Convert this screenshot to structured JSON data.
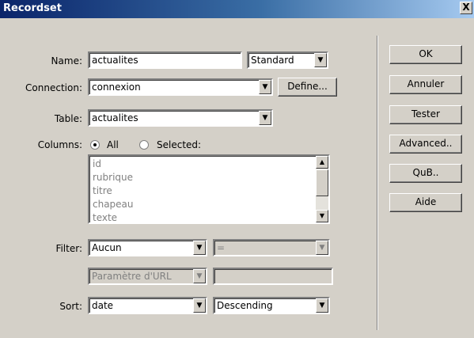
{
  "window": {
    "title": "Recordset",
    "close_label": "X"
  },
  "form": {
    "name_label": "Name:",
    "name_value": "actualites",
    "name_type": "Standard",
    "connection_label": "Connection:",
    "connection_value": "connexion",
    "define_label": "Define...",
    "table_label": "Table:",
    "table_value": "actualites",
    "columns_label": "Columns:",
    "columns_all": "All",
    "columns_selected": "Selected:",
    "columns_items": [
      "id",
      "rubrique",
      "titre",
      "chapeau",
      "texte"
    ],
    "filter_label": "Filter:",
    "filter_value": "Aucun",
    "filter_operator": "=",
    "filter_param": "Paramètre d'URL",
    "filter_param_value": "",
    "sort_label": "Sort:",
    "sort_value": "date",
    "sort_order": "Descending"
  },
  "buttons": {
    "ok": "OK",
    "cancel": "Annuler",
    "test": "Tester",
    "advanced": "Advanced..",
    "qub": "QuB..",
    "help": "Aide"
  },
  "icons": {
    "dropdown": "triangle-down",
    "scroll_up": "triangle-up",
    "scroll_down": "triangle-down",
    "radio": "radio-dot"
  }
}
